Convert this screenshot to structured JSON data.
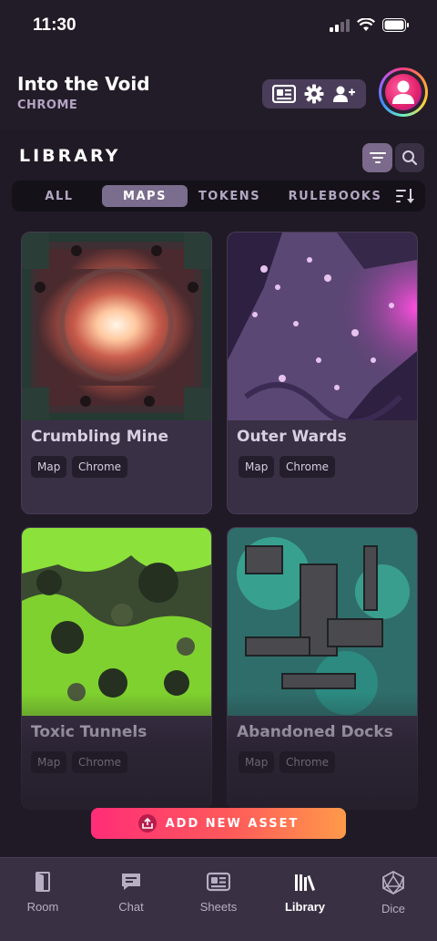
{
  "status": {
    "time": "11:30"
  },
  "header": {
    "title": "Into the Void",
    "subtitle": "CHROME",
    "tools": [
      "sheet-icon",
      "gear-icon",
      "add-user-icon"
    ]
  },
  "library": {
    "title": "LIBRARY",
    "tabs": [
      {
        "label": "ALL",
        "active": false
      },
      {
        "label": "MAPS",
        "active": true
      },
      {
        "label": "TOKENS",
        "active": false
      },
      {
        "label": "RULEBOOKS",
        "active": false
      }
    ]
  },
  "assets": [
    {
      "title": "Crumbling Mine",
      "tags": [
        "Map",
        "Chrome"
      ],
      "image": "glowing-mine-map"
    },
    {
      "title": "Outer Wards",
      "tags": [
        "Map",
        "Chrome"
      ],
      "image": "purple-crystal-cave-map"
    },
    {
      "title": "Toxic Tunnels",
      "tags": [
        "Map",
        "Chrome"
      ],
      "image": "green-toxic-cave-map"
    },
    {
      "title": "Abandoned Docks",
      "tags": [
        "Map",
        "Chrome"
      ],
      "image": "teal-docks-map"
    }
  ],
  "actions": {
    "add_asset": "ADD NEW ASSET"
  },
  "nav": [
    {
      "label": "Room",
      "icon": "door-icon",
      "active": false
    },
    {
      "label": "Chat",
      "icon": "chat-icon",
      "active": false
    },
    {
      "label": "Sheets",
      "icon": "sheet-icon",
      "active": false
    },
    {
      "label": "Library",
      "icon": "library-icon",
      "active": true
    },
    {
      "label": "Dice",
      "icon": "d20-icon",
      "active": false
    }
  ],
  "colors": {
    "background": "#1f1a25",
    "card": "#3a3045",
    "tab_active": "#7b6d8e",
    "accent_start": "#ff2d78",
    "accent_end": "#ff9a4a"
  }
}
